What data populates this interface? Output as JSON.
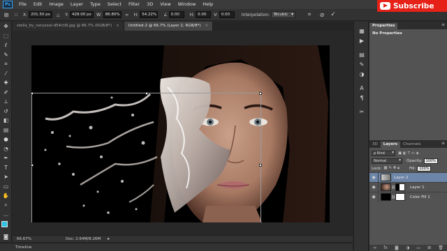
{
  "menu": {
    "logo": "Ps",
    "items": [
      "File",
      "Edit",
      "Image",
      "Layer",
      "Type",
      "Select",
      "Filter",
      "3D",
      "View",
      "Window",
      "Help"
    ]
  },
  "subscribe": {
    "label": "Subscribe"
  },
  "options": {
    "x_label": "X:",
    "x_value": "201.50 px",
    "y_label": "Y:",
    "y_value": "428.00 px",
    "w_label": "W:",
    "w_value": "86.80%",
    "h_label": "H:",
    "h_value": "54.22%",
    "rot_label": "∠",
    "rot_value": "0.00",
    "hskew_label": "H:",
    "hskew_value": "0.00",
    "vskew_label": "V:",
    "vskew_value": "0.00",
    "interp_label": "Interpolation:",
    "interp_value": "Bicubic"
  },
  "tabs": [
    {
      "label": "stella_by_nerysoul-d54ct9l.jpg @ 66.7% (RGB/8*)",
      "close": "×",
      "active": false
    },
    {
      "label": "Untitled-2 @ 66.7% (Layer 2, RGB/8*)",
      "close": "×",
      "active": true
    }
  ],
  "status": {
    "zoom": "66.67%",
    "doc": "Doc: 2.64M/8.26M"
  },
  "timeline": {
    "label": "Timeline"
  },
  "properties": {
    "tab": "Properties",
    "body": "No Properties"
  },
  "layers_panel": {
    "tabs": [
      "3D",
      "Layers",
      "Channels"
    ],
    "filter_kind": "ρ Kind",
    "blend_mode": "Normal",
    "opacity_label": "Opacity:",
    "opacity_value": "100%",
    "lock_label": "Lock:",
    "fill_label": "Fill:",
    "fill_value": "100%",
    "layers": [
      {
        "name": "Layer 2",
        "selected": true
      },
      {
        "name": "Layer 1",
        "selected": false
      },
      {
        "name": "Color Fill 1",
        "selected": false
      }
    ],
    "footer_icons": [
      "link-icon",
      "fx-icon",
      "mask-icon",
      "adjustment-icon",
      "folder-icon",
      "new-layer-icon",
      "trash-icon"
    ]
  },
  "colors": {
    "foreground": "#2ec4e8",
    "background": "#ffffff",
    "selected_layer": "#6d85a8",
    "subscribe_red": "#e62117"
  }
}
